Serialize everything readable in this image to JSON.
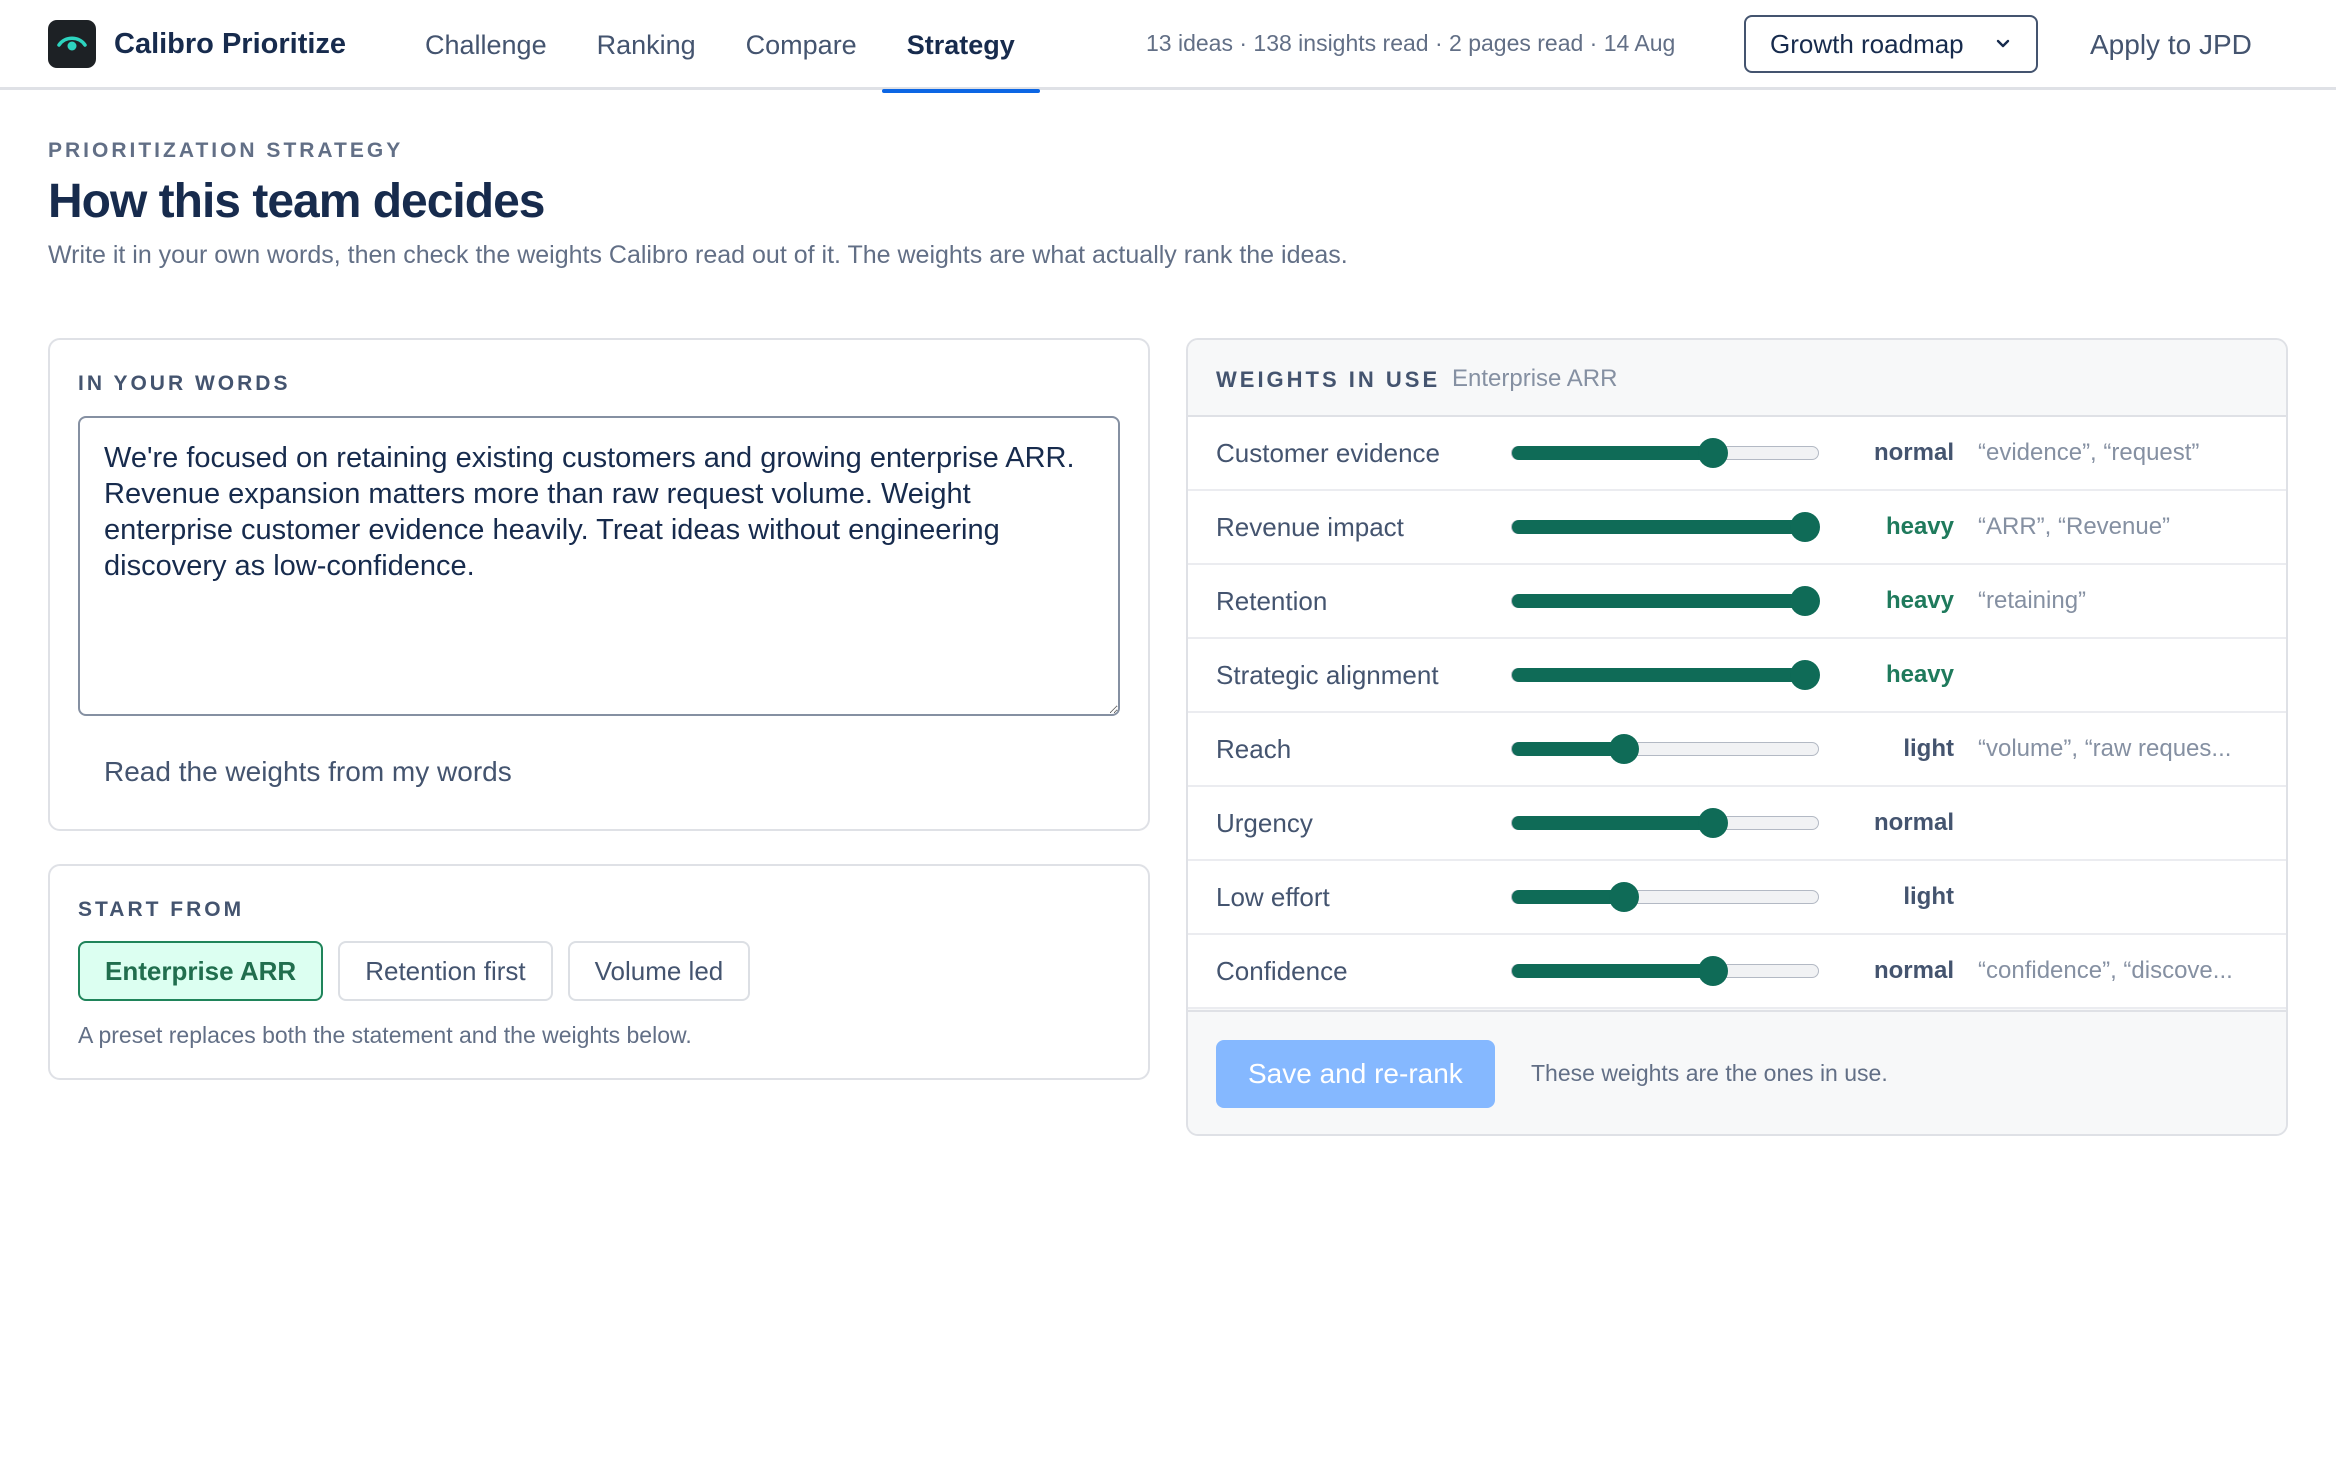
{
  "brand": {
    "name": "Calibro Prioritize",
    "logo_icon": "eye-icon"
  },
  "nav": {
    "tabs": [
      {
        "label": "Challenge",
        "active": false
      },
      {
        "label": "Ranking",
        "active": false
      },
      {
        "label": "Compare",
        "active": false
      },
      {
        "label": "Strategy",
        "active": true
      }
    ]
  },
  "header": {
    "stats": "13 ideas · 138 insights read · 2 pages read · 14 Aug",
    "roadmap_select": "Growth roadmap",
    "apply_label": "Apply to JPD"
  },
  "page": {
    "eyebrow": "PRIORITIZATION STRATEGY",
    "title": "How this team decides",
    "description": "Write it in your own words, then check the weights Calibro read out of it. The weights are what actually rank the ideas."
  },
  "words": {
    "label": "IN YOUR WORDS",
    "statement": "We're focused on retaining existing customers and growing enterprise ARR. Revenue expansion matters more than raw request volume. Weight enterprise customer evidence heavily. Treat ideas without engineering discovery as low-confidence.",
    "read_button": "Read the weights from my words"
  },
  "start_from": {
    "label": "START FROM",
    "presets": [
      {
        "label": "Enterprise ARR",
        "active": true
      },
      {
        "label": "Retention first",
        "active": false
      },
      {
        "label": "Volume led",
        "active": false
      }
    ],
    "note": "A preset replaces both the statement and the weights below."
  },
  "weights": {
    "label": "WEIGHTS IN USE",
    "preset_name": "Enterprise ARR",
    "rows": [
      {
        "name": "Customer evidence",
        "level": "normal",
        "value": 0.67,
        "keywords": "“evidence”, “request”"
      },
      {
        "name": "Revenue impact",
        "level": "heavy",
        "value": 1.0,
        "keywords": "“ARR”, “Revenue”"
      },
      {
        "name": "Retention",
        "level": "heavy",
        "value": 1.0,
        "keywords": "“retaining”"
      },
      {
        "name": "Strategic alignment",
        "level": "heavy",
        "value": 1.0,
        "keywords": ""
      },
      {
        "name": "Reach",
        "level": "light",
        "value": 0.35,
        "keywords": "“volume”, “raw reques..."
      },
      {
        "name": "Urgency",
        "level": "normal",
        "value": 0.67,
        "keywords": ""
      },
      {
        "name": "Low effort",
        "level": "light",
        "value": 0.35,
        "keywords": ""
      },
      {
        "name": "Confidence",
        "level": "normal",
        "value": 0.67,
        "keywords": "“confidence”, “discove..."
      }
    ],
    "save_button": "Save and re-rank",
    "footer_note": "These weights are the ones in use."
  },
  "colors": {
    "accent": "#0c66e4",
    "slider": "#0f6b57",
    "heavy_text": "#1f7a5c",
    "preset_active_bg": "#dcfff1",
    "save_disabled": "#85b8ff"
  }
}
